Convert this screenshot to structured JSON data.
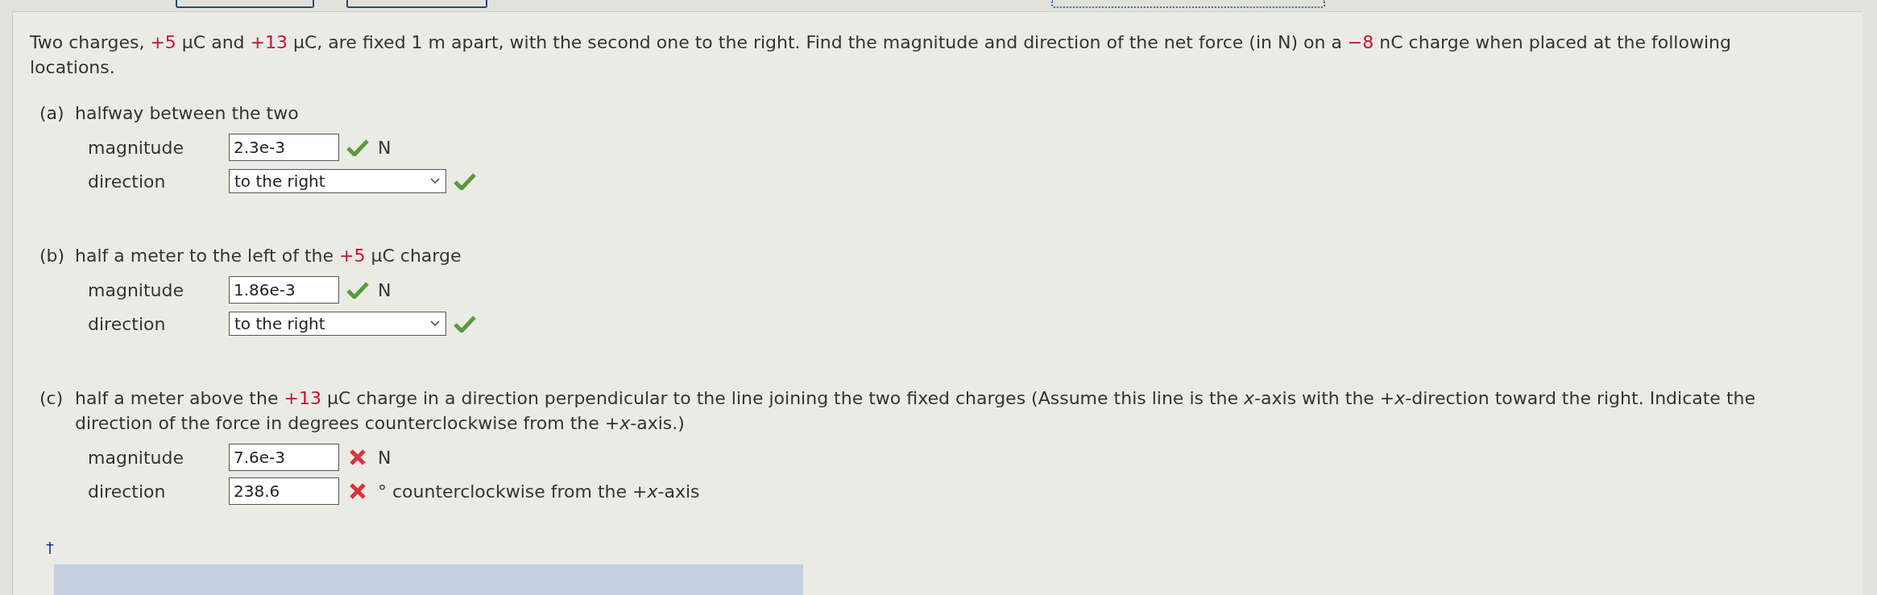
{
  "intro": [
    {
      "kind": "plain",
      "text": "Two charges, "
    },
    {
      "kind": "charge",
      "text": "+5"
    },
    {
      "kind": "plain",
      "text": " μC and "
    },
    {
      "kind": "charge",
      "text": "+13"
    },
    {
      "kind": "plain",
      "text": " μC, are fixed 1 m apart, with the second one to the right. Find the magnitude and direction of the net force (in N) on a "
    },
    {
      "kind": "charge",
      "text": "−8"
    },
    {
      "kind": "plain",
      "text": " nC charge when placed at the following locations."
    }
  ],
  "parts": [
    {
      "letter": "(a)",
      "prompt": [
        {
          "kind": "plain",
          "text": "halfway between the two"
        }
      ],
      "rows": [
        {
          "label": "magnitude",
          "kind": "input",
          "value": "2.3e-3",
          "correct": true,
          "unit": "N"
        },
        {
          "label": "direction",
          "kind": "select",
          "value": "to the right",
          "correct": true
        }
      ]
    },
    {
      "letter": "(b)",
      "prompt": [
        {
          "kind": "plain",
          "text": "half a meter to the left of the "
        },
        {
          "kind": "charge",
          "text": "+5"
        },
        {
          "kind": "plain",
          "text": " μC charge"
        }
      ],
      "rows": [
        {
          "label": "magnitude",
          "kind": "input",
          "value": "1.86e-3",
          "correct": true,
          "unit": "N"
        },
        {
          "label": "direction",
          "kind": "select",
          "value": "to the right",
          "correct": true
        }
      ]
    },
    {
      "letter": "(c)",
      "prompt": [
        {
          "kind": "plain",
          "text": "half a meter above the "
        },
        {
          "kind": "charge",
          "text": "+13"
        },
        {
          "kind": "plain",
          "text": " μC charge in a direction perpendicular to the line joining the two fixed charges (Assume this line is the *x*-axis with the +*x*-direction toward the right. Indicate the direction of the force in degrees counterclockwise from the +*x*-axis.)"
        }
      ],
      "rows": [
        {
          "label": "magnitude",
          "kind": "input",
          "value": "7.6e-3",
          "correct": false,
          "unit": "N"
        },
        {
          "label": "direction",
          "kind": "input",
          "value": "238.6",
          "correct": false,
          "unit": "° counterclockwise from the +*x*-axis"
        }
      ]
    }
  ],
  "footnote": "†"
}
